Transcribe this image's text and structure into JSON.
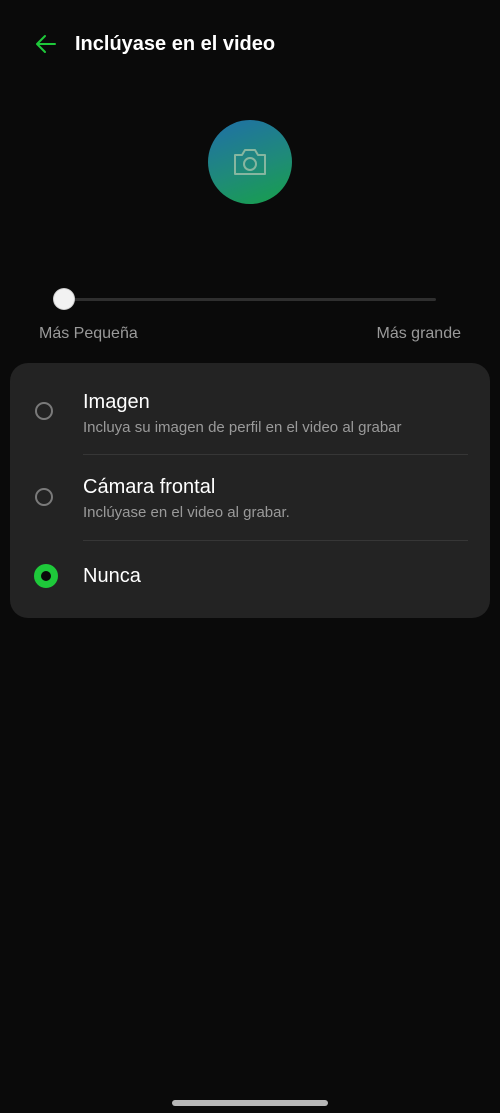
{
  "colors": {
    "accent": "#1ec93a",
    "background": "#0a0a0a",
    "card": "#232323",
    "secondary_text": "#9a9a9a"
  },
  "header": {
    "back_icon": "arrow-left-icon",
    "title": "Inclúyase en el video"
  },
  "avatar": {
    "icon": "camera-icon"
  },
  "size_slider": {
    "value": 0,
    "min_label": "Más Pequeña",
    "max_label": "Más grande"
  },
  "options": [
    {
      "title": "Imagen",
      "subtitle": "Incluya su imagen de perfil en el video al grabar",
      "selected": false
    },
    {
      "title": "Cámara frontal",
      "subtitle": "Inclúyase en el video al grabar.",
      "selected": false
    },
    {
      "title": "Nunca",
      "subtitle": "",
      "selected": true
    }
  ]
}
